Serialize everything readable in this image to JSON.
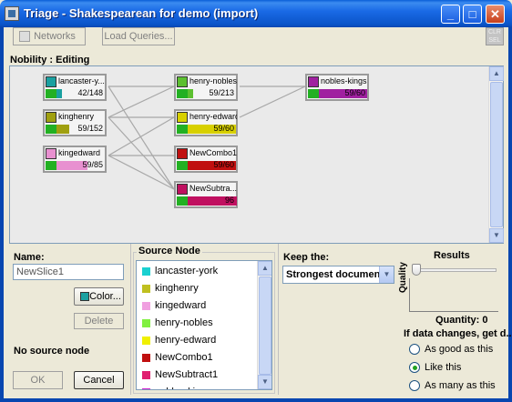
{
  "window": {
    "title": "Triage - Shakespearean for demo (import)"
  },
  "toolbar": {
    "networks_label": "Networks",
    "load_queries_label": "Load Queries...",
    "clr_sel_label_1": "CLR",
    "clr_sel_label_2": "SEL"
  },
  "graph": {
    "label": "Nobility : Editing",
    "nodes": [
      {
        "id": "lancaster",
        "label": "lancaster-y...",
        "value": "42/148",
        "color": "#1aa0a0",
        "fill": 0.28
      },
      {
        "id": "kinghenry",
        "label": "kinghenry",
        "value": "59/152",
        "color": "#a0a010",
        "fill": 0.39
      },
      {
        "id": "kingedward",
        "label": "kingedward",
        "value": "59/85",
        "color": "#e890d0",
        "fill": 0.69
      },
      {
        "id": "henry-nobles",
        "label": "henry-nobles",
        "value": "59/213",
        "color": "#5cc030",
        "fill": 0.28
      },
      {
        "id": "henry-edward",
        "label": "henry-edward",
        "value": "59/60",
        "color": "#d8d000",
        "fill": 0.98
      },
      {
        "id": "newcombo1",
        "label": "NewCombo1",
        "value": "59/60",
        "color": "#c01010",
        "fill": 0.98
      },
      {
        "id": "newsubtract",
        "label": "NewSubtra...",
        "value": "96",
        "color": "#c01060",
        "fill": 1.0
      },
      {
        "id": "nobles-kings",
        "label": "nobles-kings",
        "value": "59/60",
        "color": "#a020a0",
        "fill": 0.98
      }
    ]
  },
  "left_panel": {
    "name_label": "Name:",
    "name_value": "NewSlice1",
    "color_button": "Color...",
    "delete_button": "Delete",
    "no_source": "No source node",
    "ok_button": "OK",
    "cancel_button": "Cancel"
  },
  "source_node": {
    "title": "Source Node",
    "items": [
      {
        "label": "lancaster-york",
        "color": "#1ad0d0"
      },
      {
        "label": "kinghenry",
        "color": "#c0c020"
      },
      {
        "label": "kingedward",
        "color": "#f0a0e0"
      },
      {
        "label": "henry-nobles",
        "color": "#80f040"
      },
      {
        "label": "henry-edward",
        "color": "#f0f000"
      },
      {
        "label": "NewCombo1",
        "color": "#c01010"
      },
      {
        "label": "NewSubtract1",
        "color": "#e02070"
      },
      {
        "label": "nobles-kings",
        "color": "#d020d0"
      }
    ]
  },
  "right_panel": {
    "keep_label": "Keep the:",
    "keep_value": "Strongest documents",
    "results_label": "Results",
    "quality_label": "Quality",
    "quantity_text": "Quantity: 0",
    "if_changes_text": "If data changes, get d...",
    "radios": [
      {
        "label": "As good as this",
        "selected": false
      },
      {
        "label": "Like this",
        "selected": true
      },
      {
        "label": "As many as this",
        "selected": false
      }
    ]
  }
}
